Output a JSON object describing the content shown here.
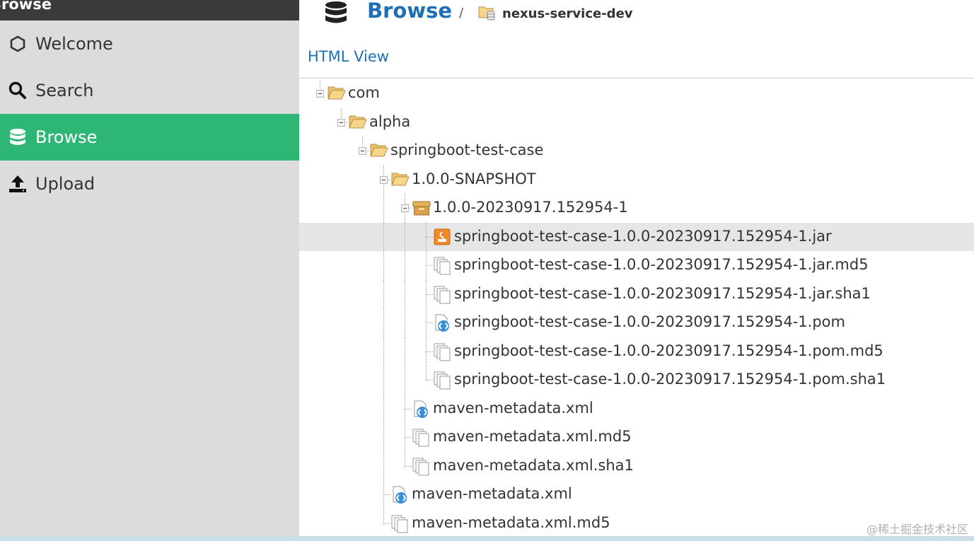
{
  "sidebar": {
    "title": "Browse",
    "items": [
      {
        "label": "Welcome",
        "icon": "hexagon-icon",
        "active": false
      },
      {
        "label": "Search",
        "icon": "search-icon",
        "active": false
      },
      {
        "label": "Browse",
        "icon": "database-icon",
        "active": true
      },
      {
        "label": "Upload",
        "icon": "upload-icon",
        "active": false
      }
    ]
  },
  "header": {
    "title": "Browse",
    "separator": "/",
    "repository": "nexus-service-dev"
  },
  "html_view_link": "HTML View",
  "tree": [
    {
      "label": "com",
      "type": "folder",
      "depth": 0,
      "selected": false
    },
    {
      "label": "alpha",
      "type": "folder",
      "depth": 1,
      "selected": false
    },
    {
      "label": "springboot-test-case",
      "type": "folder",
      "depth": 2,
      "selected": false
    },
    {
      "label": "1.0.0-SNAPSHOT",
      "type": "folder",
      "depth": 3,
      "selected": false
    },
    {
      "label": "1.0.0-20230917.152954-1",
      "type": "component",
      "depth": 4,
      "selected": false
    },
    {
      "label": "springboot-test-case-1.0.0-20230917.152954-1.jar",
      "type": "jar",
      "depth": 5,
      "selected": true
    },
    {
      "label": "springboot-test-case-1.0.0-20230917.152954-1.jar.md5",
      "type": "file",
      "depth": 5,
      "selected": false
    },
    {
      "label": "springboot-test-case-1.0.0-20230917.152954-1.jar.sha1",
      "type": "file",
      "depth": 5,
      "selected": false
    },
    {
      "label": "springboot-test-case-1.0.0-20230917.152954-1.pom",
      "type": "xml",
      "depth": 5,
      "selected": false
    },
    {
      "label": "springboot-test-case-1.0.0-20230917.152954-1.pom.md5",
      "type": "file",
      "depth": 5,
      "selected": false
    },
    {
      "label": "springboot-test-case-1.0.0-20230917.152954-1.pom.sha1",
      "type": "file",
      "depth": 5,
      "selected": false
    },
    {
      "label": "maven-metadata.xml",
      "type": "xml",
      "depth": 4,
      "selected": false
    },
    {
      "label": "maven-metadata.xml.md5",
      "type": "file",
      "depth": 4,
      "selected": false
    },
    {
      "label": "maven-metadata.xml.sha1",
      "type": "file",
      "depth": 4,
      "selected": false
    },
    {
      "label": "maven-metadata.xml",
      "type": "xml",
      "depth": 3,
      "selected": false
    },
    {
      "label": "maven-metadata.xml.md5",
      "type": "file",
      "depth": 3,
      "selected": false
    }
  ],
  "watermark": "@稀土掘金技术社区",
  "colors": {
    "active_nav": "#2db674",
    "link": "#1f6fb5",
    "sidebar_bg": "#dcdcdc",
    "selected_row": "#e6e6e6"
  }
}
